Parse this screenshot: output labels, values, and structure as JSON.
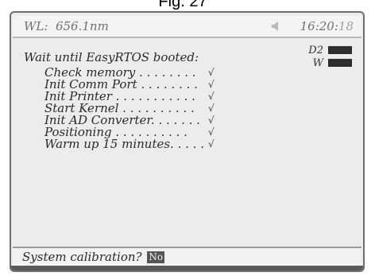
{
  "figure": {
    "title": "Fig. 27"
  },
  "header": {
    "wavelength": "WL:  656.1nm",
    "time_main": "16:20:",
    "time_seconds": "18",
    "speaker_icon": "speaker-icon"
  },
  "status": {
    "d2_label": "D2",
    "w_label": "W"
  },
  "boot": {
    "title": "Wait until EasyRTOS booted:",
    "steps": [
      {
        "label": "Check memory . . . . . . . .",
        "check": "√"
      },
      {
        "label": "Init Comm Port . . . . . . . .",
        "check": "√"
      },
      {
        "label": "Init Printer . . . . . . . . . . .",
        "check": "√"
      },
      {
        "label": "Start Kernel . . . . . . . . . .",
        "check": "√"
      },
      {
        "label": "Init AD Converter. . . . . . .",
        "check": "√"
      },
      {
        "label": "Positioning . . . . . . . . . .",
        "check": "√"
      },
      {
        "label": "Warm up 15 minutes. . . . .",
        "check": "√"
      }
    ]
  },
  "footer": {
    "prompt": "System calibration?",
    "answer": "No"
  }
}
